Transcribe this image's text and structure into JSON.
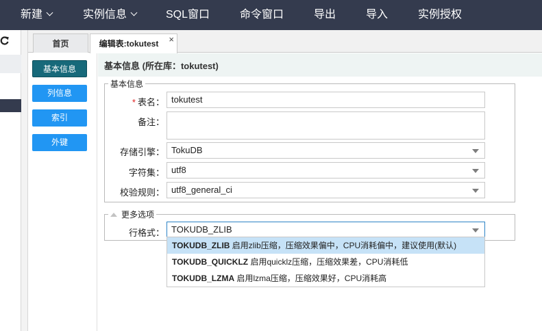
{
  "topnav": {
    "items": [
      {
        "label": "新建",
        "dropdown": true
      },
      {
        "label": "实例信息",
        "dropdown": true
      },
      {
        "label": "SQL窗口",
        "dropdown": false
      },
      {
        "label": "命令窗口",
        "dropdown": false
      },
      {
        "label": "导出",
        "dropdown": false
      },
      {
        "label": "导入",
        "dropdown": false
      },
      {
        "label": "实例授权",
        "dropdown": false
      }
    ]
  },
  "tabs": [
    {
      "label": "首页",
      "active": false
    },
    {
      "label": "编辑表:tokutest",
      "active": true,
      "close": "×"
    }
  ],
  "sidebar": {
    "buttons": [
      {
        "label": "基本信息",
        "active": true
      },
      {
        "label": "列信息",
        "active": false
      },
      {
        "label": "索引",
        "active": false
      },
      {
        "label": "外键",
        "active": false
      }
    ]
  },
  "panel": {
    "title": "基本信息 (所在库：tokutest)"
  },
  "basic_group": {
    "legend": "基本信息",
    "table_name": {
      "required_mark": "*",
      "label": "表名：",
      "value": "tokutest"
    },
    "comment": {
      "label": "备注：",
      "value": ""
    },
    "engine": {
      "label": "存储引擎：",
      "value": "TokuDB"
    },
    "charset": {
      "label": "字符集：",
      "value": "utf8"
    },
    "collation": {
      "label": "校验规则：",
      "value": "utf8_general_ci"
    }
  },
  "more_group": {
    "legend": "更多选项",
    "row_format": {
      "label": "行格式：",
      "value": "TOKUDB_ZLIB"
    },
    "options": [
      {
        "name": "TOKUDB_ZLIB",
        "desc": " 启用zlib压缩，压缩效果偏中，CPU消耗偏中，建议使用(默认)",
        "selected": true
      },
      {
        "name": "TOKUDB_QUICKLZ",
        "desc": " 启用quicklz压缩，压缩效果差，CPU消耗低",
        "selected": false
      },
      {
        "name": "TOKUDB_LZMA",
        "desc": " 启用lzma压缩，压缩效果好，CPU消耗高",
        "selected": false
      }
    ]
  },
  "colors": {
    "navbar": "#343b4e",
    "active_button": "#17697a",
    "button": "#2196f3",
    "selected_option": "#c6e2f7",
    "required": "#e02020"
  },
  "icons": {
    "refresh": "refresh-icon"
  }
}
